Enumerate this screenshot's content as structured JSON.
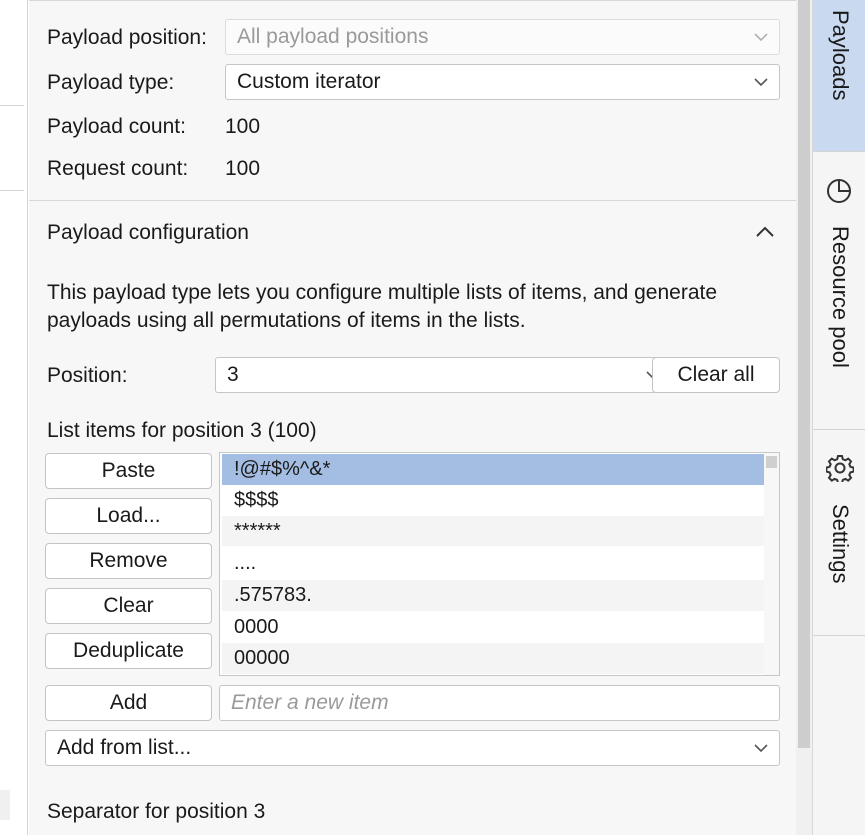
{
  "payload_settings": {
    "position_label": "Payload position:",
    "position_value": "All payload positions",
    "type_label": "Payload type:",
    "type_value": "Custom iterator",
    "count_label": "Payload count:",
    "count_value": "100",
    "request_label": "Request count:",
    "request_value": "100"
  },
  "config": {
    "title": "Payload configuration",
    "description_line1": "This payload type lets you configure multiple lists of items, and generate",
    "description_line2": "payloads using all permutations of items in the lists.",
    "position_label": "Position:",
    "position_value": "3",
    "clear_all_label": "Clear all",
    "list_title": "List items for position 3 (100)",
    "buttons": {
      "paste": "Paste",
      "load": "Load...",
      "remove": "Remove",
      "clear": "Clear",
      "deduplicate": "Deduplicate",
      "add": "Add"
    },
    "items": [
      "!@#$%^&*",
      "$$$$",
      "******",
      "....",
      ".575783.",
      "0000",
      "00000"
    ],
    "new_item_placeholder": "Enter a new item",
    "add_from_list_label": "Add from list...",
    "separator_label": "Separator for position 3"
  },
  "sidebar": {
    "tabs": [
      {
        "label": "Payloads",
        "icon": null,
        "active": true
      },
      {
        "label": "Resource pool",
        "icon": "pie-chart-icon",
        "active": false
      },
      {
        "label": "Settings",
        "icon": "gear-icon",
        "active": false
      }
    ]
  },
  "colors": {
    "accent_tab": "#c8d9f0",
    "selected_item": "#a3bde3"
  }
}
